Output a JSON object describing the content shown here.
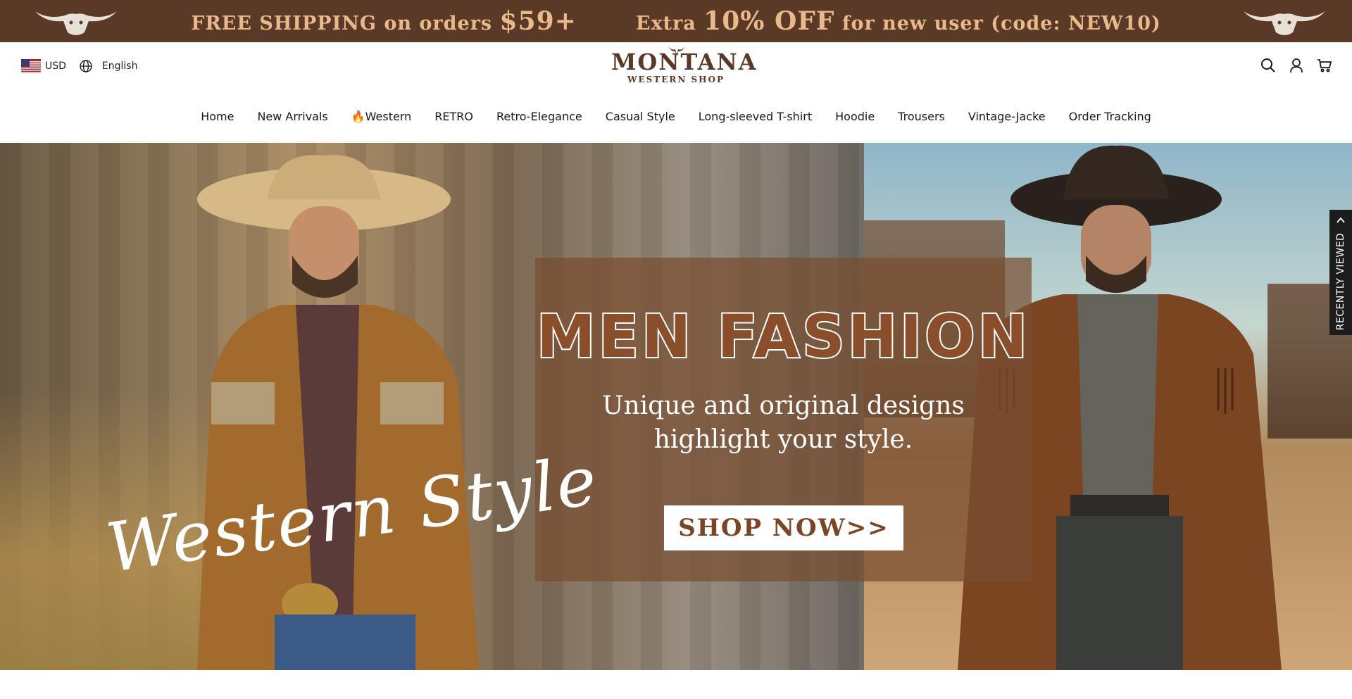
{
  "announcement": {
    "shipping_prefix": "FREE SHIPPING on orders ",
    "shipping_amount": "$59+",
    "offer_prefix": "Extra ",
    "offer_amount": "10% OFF",
    "offer_suffix": " for new user (code: NEW10)",
    "background": "#5a3a27",
    "text_color": "#e9b98b",
    "icons": [
      "longhorn-skull-icon",
      "longhorn-skull-icon"
    ]
  },
  "header": {
    "currency": "USD",
    "currency_flag_icon": "us-flag-icon",
    "language_icon": "globe-icon",
    "language": "English",
    "logo": {
      "main": "MONTANA",
      "sub": "WESTERN SHOP",
      "color": "#5a3a27"
    },
    "icons": [
      "search-icon",
      "account-icon",
      "cart-icon"
    ]
  },
  "nav": {
    "items": [
      "Home",
      "New Arrivals",
      "🔥Western",
      "RETRO",
      "Retro-Elegance",
      "Casual Style",
      "Long-sleeved T-shirt",
      "Hoodie",
      "Trousers",
      "Vintage-Jacke",
      "Order Tracking"
    ]
  },
  "hero": {
    "headline": "MEN FASHION",
    "subhead_line1": "Unique and original designs",
    "subhead_line2": "highlight your style.",
    "cta": "SHOP NOW>>",
    "script_text": "Western Style",
    "overlay_color": "#794e30",
    "accent_color": "#8a4f2a"
  },
  "recently_viewed": {
    "label": "RECENTLY VIEWED",
    "icon": "chevron-up-icon"
  }
}
